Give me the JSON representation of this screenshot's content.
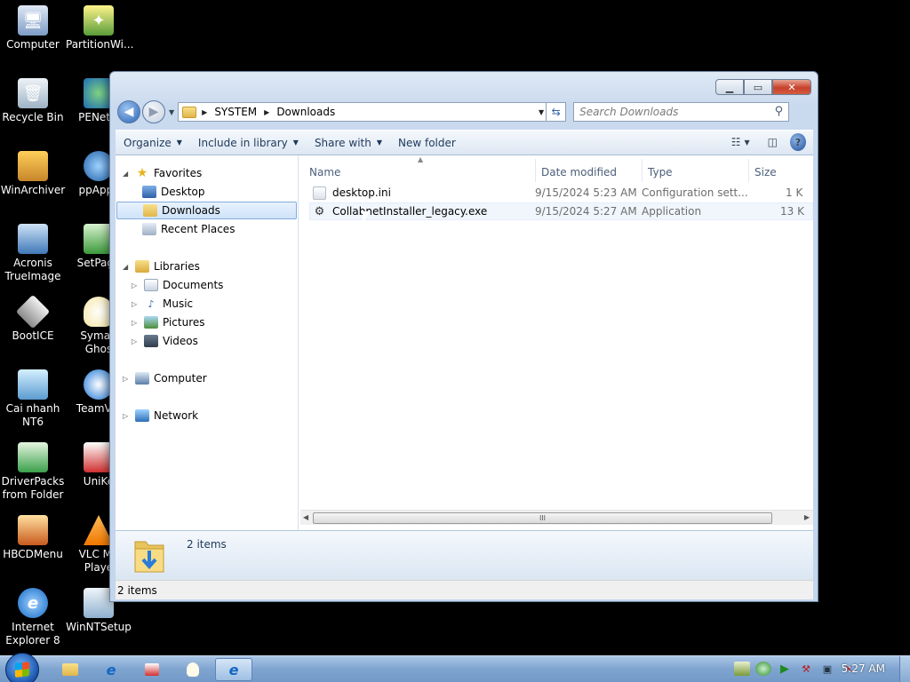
{
  "desktop_icons": [
    {
      "label": "Computer"
    },
    {
      "label": "PartitionWi..."
    },
    {
      "label": "Recycle Bin"
    },
    {
      "label": "PENetw"
    },
    {
      "label": "WinArchiver"
    },
    {
      "label": "ppApps"
    },
    {
      "label": "Acronis\nTrueImage"
    },
    {
      "label": "SetPage"
    },
    {
      "label": "BootICE"
    },
    {
      "label": "Syman\nGhos"
    },
    {
      "label": "Cai nhanh\nNT6"
    },
    {
      "label": "TeamVie"
    },
    {
      "label": "DriverPacks\nfrom Folder"
    },
    {
      "label": "UniKe"
    },
    {
      "label": "HBCDMenu"
    },
    {
      "label": "VLC Me\nPlaye"
    },
    {
      "label": "Internet\nExplorer 8"
    },
    {
      "label": "WinNTSetup"
    }
  ],
  "window": {
    "controls": {
      "minimize": "▁",
      "maximize": "▭",
      "close": "✕"
    },
    "address": {
      "crumbs": [
        "SYSTEM",
        "Downloads"
      ]
    },
    "search": {
      "placeholder": "Search Downloads"
    },
    "toolbar": {
      "organize": "Organize",
      "include_in_library": "Include in library",
      "share_with": "Share with",
      "new_folder": "New folder"
    },
    "nav_pane": {
      "favorites": "Favorites",
      "desktop": "Desktop",
      "downloads": "Downloads",
      "recent_places": "Recent Places",
      "libraries": "Libraries",
      "documents": "Documents",
      "music": "Music",
      "pictures": "Pictures",
      "videos": "Videos",
      "computer": "Computer",
      "network": "Network"
    },
    "columns": {
      "name": "Name",
      "date_modified": "Date modified",
      "type": "Type",
      "size": "Size"
    },
    "files": [
      {
        "name": "desktop.ini",
        "date": "9/15/2024 5:23 AM",
        "type": "Configuration sett...",
        "size": "1 K"
      },
      {
        "name": "CollabnetInstaller_legacy.exe",
        "date": "9/15/2024 5:27 AM",
        "type": "Application",
        "size": "13 K"
      }
    ],
    "details": {
      "count": "2 items"
    },
    "status": {
      "text": "2 items"
    }
  },
  "taskbar": {
    "clock": "5:27 AM"
  }
}
